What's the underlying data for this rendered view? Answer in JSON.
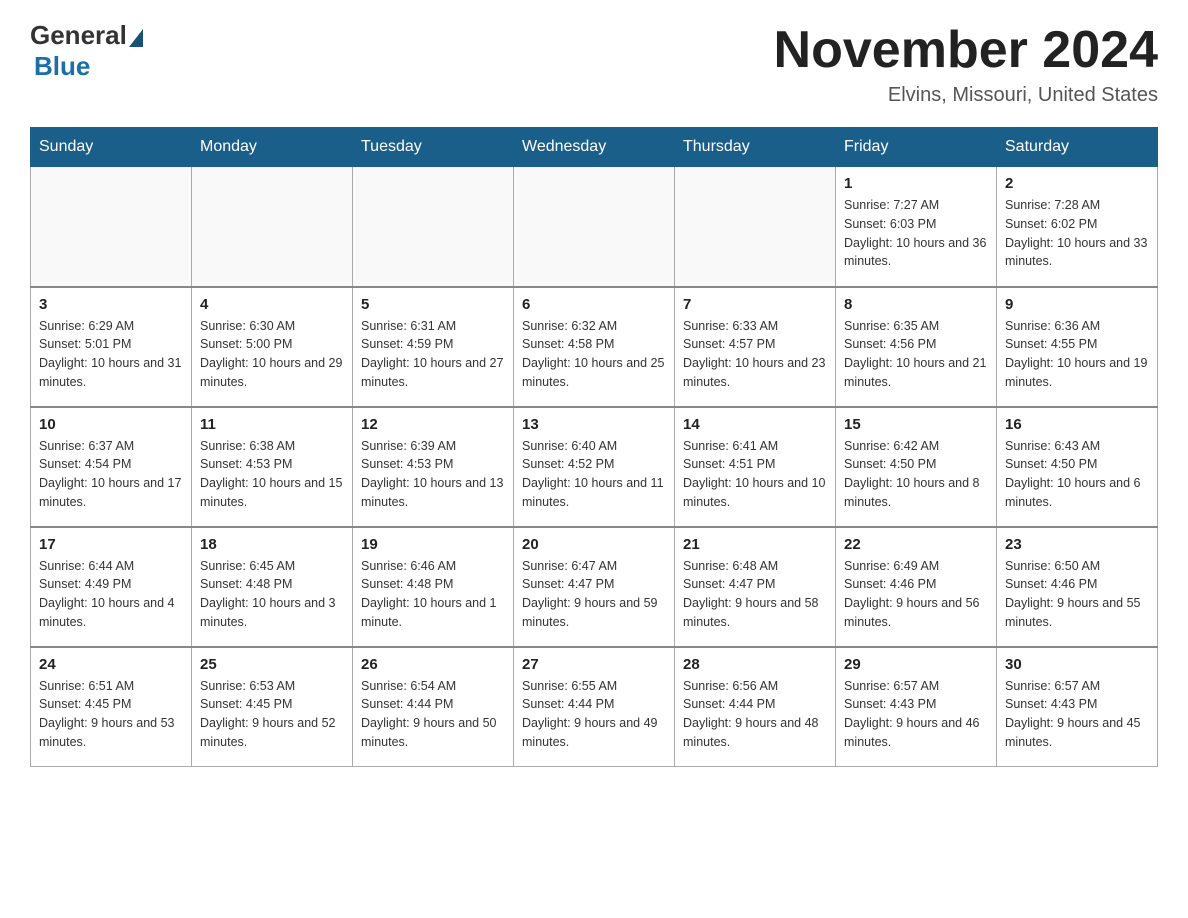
{
  "header": {
    "logo_general": "General",
    "logo_blue": "Blue",
    "month_title": "November 2024",
    "location": "Elvins, Missouri, United States"
  },
  "days_of_week": [
    "Sunday",
    "Monday",
    "Tuesday",
    "Wednesday",
    "Thursday",
    "Friday",
    "Saturday"
  ],
  "weeks": [
    [
      {
        "day": "",
        "info": ""
      },
      {
        "day": "",
        "info": ""
      },
      {
        "day": "",
        "info": ""
      },
      {
        "day": "",
        "info": ""
      },
      {
        "day": "",
        "info": ""
      },
      {
        "day": "1",
        "info": "Sunrise: 7:27 AM\nSunset: 6:03 PM\nDaylight: 10 hours and 36 minutes."
      },
      {
        "day": "2",
        "info": "Sunrise: 7:28 AM\nSunset: 6:02 PM\nDaylight: 10 hours and 33 minutes."
      }
    ],
    [
      {
        "day": "3",
        "info": "Sunrise: 6:29 AM\nSunset: 5:01 PM\nDaylight: 10 hours and 31 minutes."
      },
      {
        "day": "4",
        "info": "Sunrise: 6:30 AM\nSunset: 5:00 PM\nDaylight: 10 hours and 29 minutes."
      },
      {
        "day": "5",
        "info": "Sunrise: 6:31 AM\nSunset: 4:59 PM\nDaylight: 10 hours and 27 minutes."
      },
      {
        "day": "6",
        "info": "Sunrise: 6:32 AM\nSunset: 4:58 PM\nDaylight: 10 hours and 25 minutes."
      },
      {
        "day": "7",
        "info": "Sunrise: 6:33 AM\nSunset: 4:57 PM\nDaylight: 10 hours and 23 minutes."
      },
      {
        "day": "8",
        "info": "Sunrise: 6:35 AM\nSunset: 4:56 PM\nDaylight: 10 hours and 21 minutes."
      },
      {
        "day": "9",
        "info": "Sunrise: 6:36 AM\nSunset: 4:55 PM\nDaylight: 10 hours and 19 minutes."
      }
    ],
    [
      {
        "day": "10",
        "info": "Sunrise: 6:37 AM\nSunset: 4:54 PM\nDaylight: 10 hours and 17 minutes."
      },
      {
        "day": "11",
        "info": "Sunrise: 6:38 AM\nSunset: 4:53 PM\nDaylight: 10 hours and 15 minutes."
      },
      {
        "day": "12",
        "info": "Sunrise: 6:39 AM\nSunset: 4:53 PM\nDaylight: 10 hours and 13 minutes."
      },
      {
        "day": "13",
        "info": "Sunrise: 6:40 AM\nSunset: 4:52 PM\nDaylight: 10 hours and 11 minutes."
      },
      {
        "day": "14",
        "info": "Sunrise: 6:41 AM\nSunset: 4:51 PM\nDaylight: 10 hours and 10 minutes."
      },
      {
        "day": "15",
        "info": "Sunrise: 6:42 AM\nSunset: 4:50 PM\nDaylight: 10 hours and 8 minutes."
      },
      {
        "day": "16",
        "info": "Sunrise: 6:43 AM\nSunset: 4:50 PM\nDaylight: 10 hours and 6 minutes."
      }
    ],
    [
      {
        "day": "17",
        "info": "Sunrise: 6:44 AM\nSunset: 4:49 PM\nDaylight: 10 hours and 4 minutes."
      },
      {
        "day": "18",
        "info": "Sunrise: 6:45 AM\nSunset: 4:48 PM\nDaylight: 10 hours and 3 minutes."
      },
      {
        "day": "19",
        "info": "Sunrise: 6:46 AM\nSunset: 4:48 PM\nDaylight: 10 hours and 1 minute."
      },
      {
        "day": "20",
        "info": "Sunrise: 6:47 AM\nSunset: 4:47 PM\nDaylight: 9 hours and 59 minutes."
      },
      {
        "day": "21",
        "info": "Sunrise: 6:48 AM\nSunset: 4:47 PM\nDaylight: 9 hours and 58 minutes."
      },
      {
        "day": "22",
        "info": "Sunrise: 6:49 AM\nSunset: 4:46 PM\nDaylight: 9 hours and 56 minutes."
      },
      {
        "day": "23",
        "info": "Sunrise: 6:50 AM\nSunset: 4:46 PM\nDaylight: 9 hours and 55 minutes."
      }
    ],
    [
      {
        "day": "24",
        "info": "Sunrise: 6:51 AM\nSunset: 4:45 PM\nDaylight: 9 hours and 53 minutes."
      },
      {
        "day": "25",
        "info": "Sunrise: 6:53 AM\nSunset: 4:45 PM\nDaylight: 9 hours and 52 minutes."
      },
      {
        "day": "26",
        "info": "Sunrise: 6:54 AM\nSunset: 4:44 PM\nDaylight: 9 hours and 50 minutes."
      },
      {
        "day": "27",
        "info": "Sunrise: 6:55 AM\nSunset: 4:44 PM\nDaylight: 9 hours and 49 minutes."
      },
      {
        "day": "28",
        "info": "Sunrise: 6:56 AM\nSunset: 4:44 PM\nDaylight: 9 hours and 48 minutes."
      },
      {
        "day": "29",
        "info": "Sunrise: 6:57 AM\nSunset: 4:43 PM\nDaylight: 9 hours and 46 minutes."
      },
      {
        "day": "30",
        "info": "Sunrise: 6:57 AM\nSunset: 4:43 PM\nDaylight: 9 hours and 45 minutes."
      }
    ]
  ]
}
